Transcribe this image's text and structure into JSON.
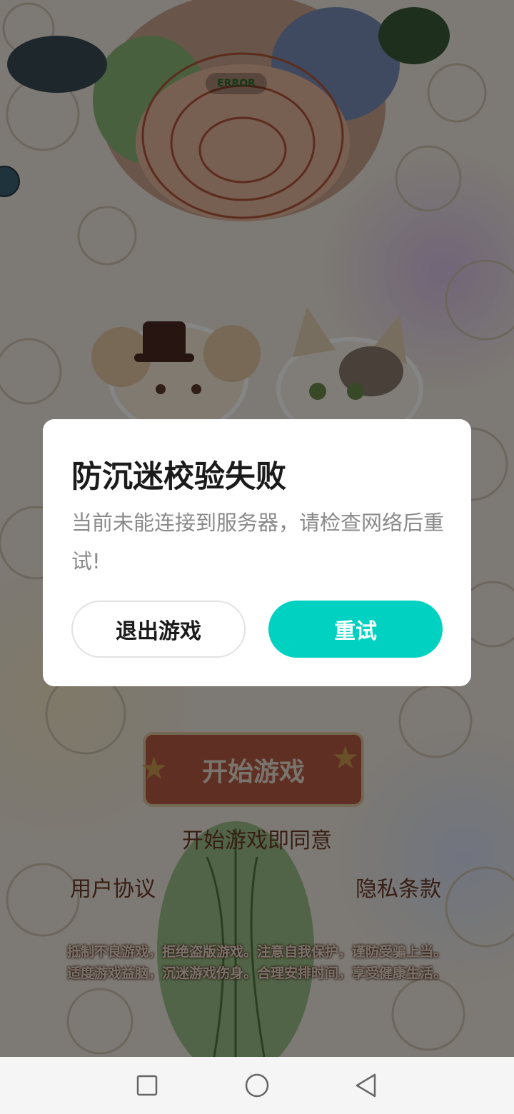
{
  "background": {
    "top_pill": "ERROR",
    "start_button": "开始游戏",
    "agree_text": "开始游戏即同意",
    "user_agreement": "用户协议",
    "privacy_policy": "隐私条款",
    "health_notice_line1": "抵制不良游戏，拒绝盗版游戏。注意自我保护，谨防受骗上当。",
    "health_notice_line2": "适度游戏益脑，沉迷游戏伤身。合理安排时间，享受健康生活。"
  },
  "dialog": {
    "title": "防沉迷校验失败",
    "message": "当前未能连接到服务器，请检查网络后重试!",
    "exit_button": "退出游戏",
    "retry_button": "重试"
  },
  "navbar": {
    "icons": [
      "square-recents-icon",
      "circle-home-icon",
      "triangle-back-icon"
    ]
  },
  "colors": {
    "retry_button": "#00d1c1",
    "dialog_bg": "#ffffff",
    "start_button": "#b85b45"
  }
}
